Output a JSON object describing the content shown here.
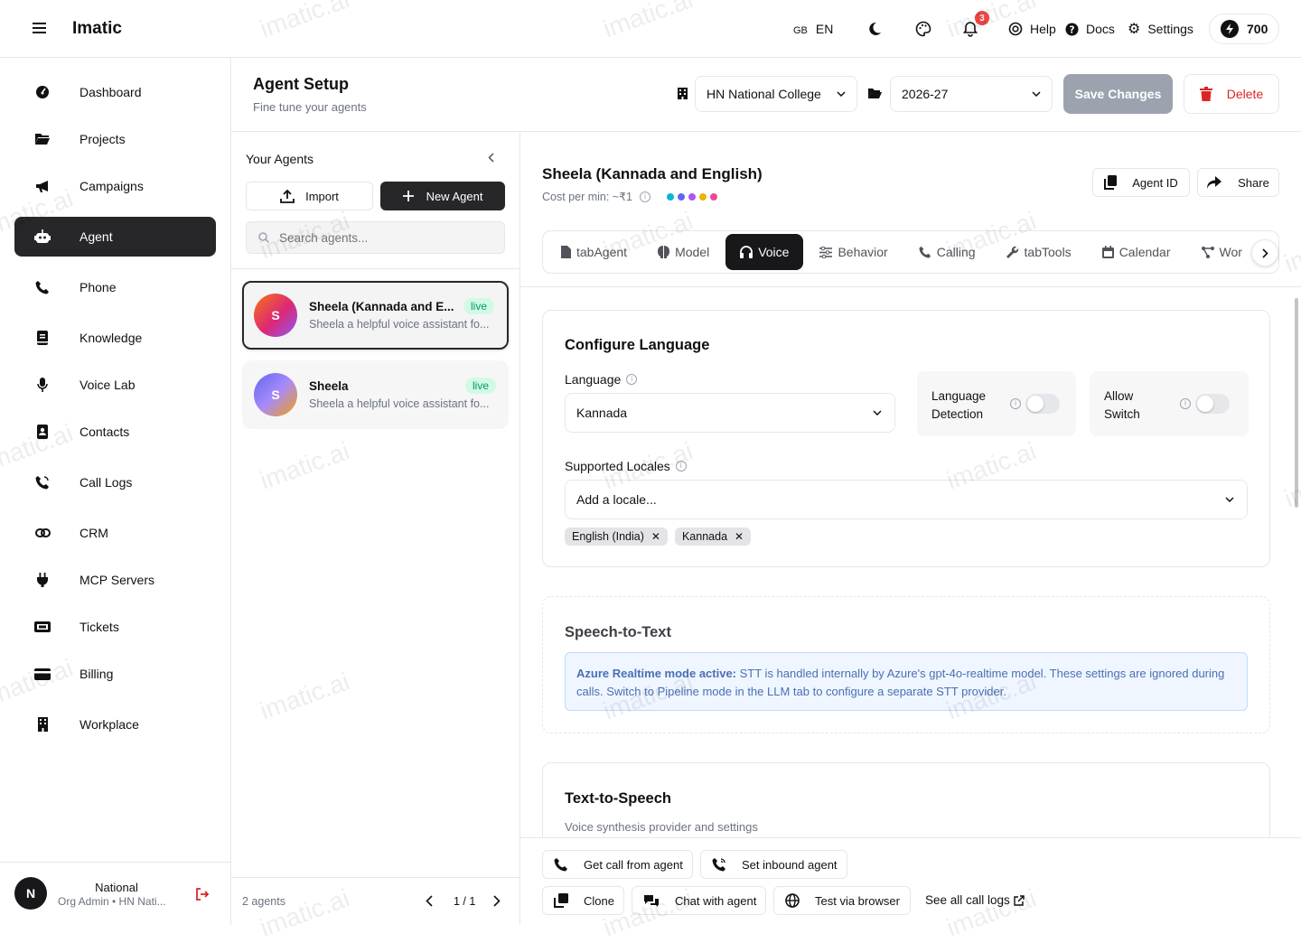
{
  "topbar": {
    "app_name": "Imatic",
    "lang_flag": "GB",
    "lang_code": "EN",
    "notifications_count": "3",
    "help_label": "Help",
    "docs_label": "Docs",
    "settings_label": "Settings",
    "credits": "700"
  },
  "sidebar": {
    "items": [
      {
        "label": "Dashboard",
        "icon": "gauge-icon"
      },
      {
        "label": "Projects",
        "icon": "folder-icon"
      },
      {
        "label": "Campaigns",
        "icon": "megaphone-icon"
      },
      {
        "label": "Agent",
        "icon": "robot-icon"
      },
      {
        "label": "Phone",
        "icon": "phone-icon"
      },
      {
        "label": "Knowledge",
        "icon": "book-icon"
      },
      {
        "label": "Voice Lab",
        "icon": "microphone-icon"
      },
      {
        "label": "Contacts",
        "icon": "contact-book-icon"
      },
      {
        "label": "Call Logs",
        "icon": "phone-volume-icon"
      },
      {
        "label": "CRM",
        "icon": "link-icon"
      },
      {
        "label": "MCP Servers",
        "icon": "plug-icon"
      },
      {
        "label": "Tickets",
        "icon": "ticket-icon"
      },
      {
        "label": "Billing",
        "icon": "credit-card-icon"
      },
      {
        "label": "Workplace",
        "icon": "building-icon"
      }
    ],
    "active_index": 3,
    "user": {
      "initial": "N",
      "name": "National",
      "role": "Org Admin • HN Nati..."
    }
  },
  "header": {
    "title": "Agent Setup",
    "subtitle": "Fine tune your agents",
    "org_select": "HN National College",
    "year_select": "2026-27",
    "save_label": "Save Changes",
    "delete_label": "Delete"
  },
  "agents_panel": {
    "title": "Your Agents",
    "import_label": "Import",
    "new_agent_label": "New Agent",
    "search_placeholder": "Search agents...",
    "agents": [
      {
        "initial": "S",
        "name": "Sheela (Kannada and E...",
        "desc": "Sheela a helpful voice assistant fo...",
        "status": "live"
      },
      {
        "initial": "S",
        "name": "Sheela",
        "desc": "Sheela a helpful voice assistant fo...",
        "status": "live"
      }
    ],
    "count_label": "2 agents",
    "page_label": "1 / 1"
  },
  "agent_detail": {
    "name": "Sheela (Kannada and English)",
    "cost_label": "Cost per min: ~₹1",
    "dot_colors": [
      "#06b6d4",
      "#6366f1",
      "#a855f7",
      "#eab308",
      "#ec4899"
    ],
    "agent_id_label": "Agent ID",
    "share_label": "Share",
    "tabs": [
      "tabAgent",
      "Model",
      "Voice",
      "Behavior",
      "Calling",
      "tabTools",
      "Calendar",
      "Wor"
    ],
    "active_tab": "Voice"
  },
  "configure_language": {
    "title": "Configure Language",
    "language_label": "Language",
    "language_value": "Kannada",
    "detection_label_1": "Language",
    "detection_label_2": "Detection",
    "allow_label_1": "Allow",
    "allow_label_2": "Switch",
    "locales_label": "Supported Locales",
    "locales_placeholder": "Add a locale...",
    "locales": [
      "English (India)",
      "Kannada"
    ]
  },
  "stt": {
    "title": "Speech-to-Text",
    "notice_bold": "Azure Realtime mode active:",
    "notice_text": " STT is handled internally by Azure's gpt-4o-realtime model. These settings are ignored during calls. Switch to Pipeline mode in the LLM tab to configure a separate STT provider."
  },
  "tts": {
    "title": "Text-to-Speech",
    "subtitle": "Voice synthesis provider and settings"
  },
  "actions": {
    "get_call": "Get call from agent",
    "set_inbound": "Set inbound agent",
    "clone": "Clone",
    "chat": "Chat with agent",
    "test_browser": "Test via browser",
    "see_logs": "See all call logs"
  },
  "watermark": "imatic.ai",
  "colors": {
    "dark": "#27272a",
    "accent_red": "#dc2626",
    "live_green": "#059669",
    "notice_blue": "#4a6fb5"
  }
}
